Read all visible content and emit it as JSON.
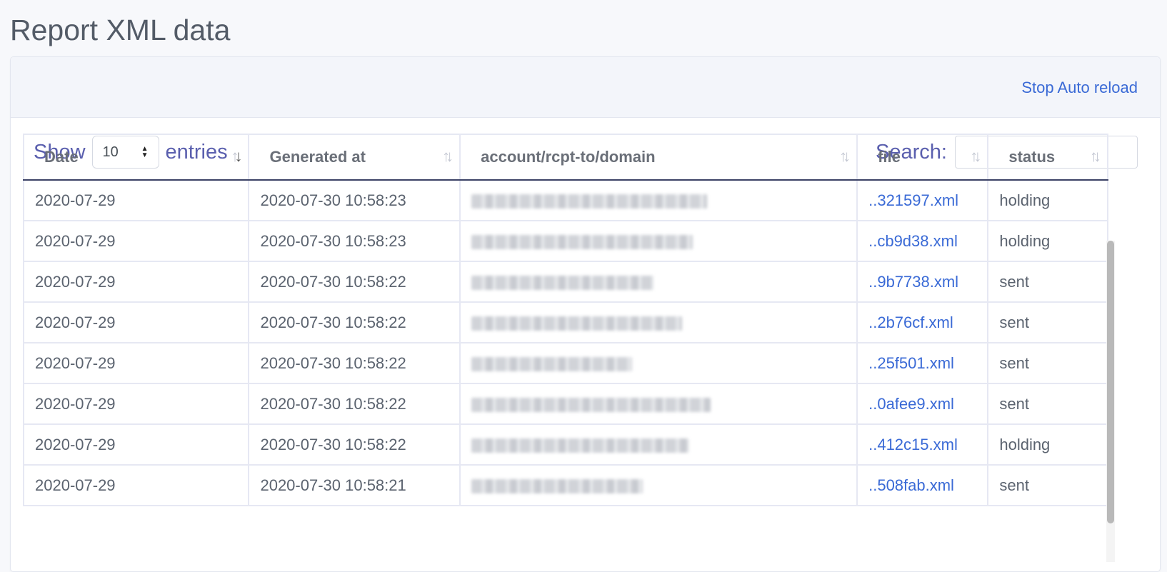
{
  "page": {
    "title": "Report XML data"
  },
  "header": {
    "stop_reload_label": "Stop Auto reload"
  },
  "controls": {
    "show_label": "Show",
    "entries_value": "10",
    "entries_label": "entries",
    "search_label": "Search:",
    "search_value": ""
  },
  "table": {
    "columns": [
      {
        "label": "Date",
        "sorted": "desc"
      },
      {
        "label": "Generated at",
        "sorted": "none"
      },
      {
        "label": "account/rcpt-to/domain",
        "sorted": "none"
      },
      {
        "label": "file",
        "sorted": "none"
      },
      {
        "label": "status",
        "sorted": "none"
      }
    ],
    "rows": [
      {
        "date": "2020-07-29",
        "generated": "2020-07-30 10:58:23",
        "domain_redacted": true,
        "file": "..321597.xml",
        "status": "holding"
      },
      {
        "date": "2020-07-29",
        "generated": "2020-07-30 10:58:23",
        "domain_redacted": true,
        "file": "..cb9d38.xml",
        "status": "holding"
      },
      {
        "date": "2020-07-29",
        "generated": "2020-07-30 10:58:22",
        "domain_redacted": true,
        "file": "..9b7738.xml",
        "status": "sent"
      },
      {
        "date": "2020-07-29",
        "generated": "2020-07-30 10:58:22",
        "domain_redacted": true,
        "file": "..2b76cf.xml",
        "status": "sent"
      },
      {
        "date": "2020-07-29",
        "generated": "2020-07-30 10:58:22",
        "domain_redacted": true,
        "file": "..25f501.xml",
        "status": "sent"
      },
      {
        "date": "2020-07-29",
        "generated": "2020-07-30 10:58:22",
        "domain_redacted": true,
        "file": "..0afee9.xml",
        "status": "sent"
      },
      {
        "date": "2020-07-29",
        "generated": "2020-07-30 10:58:22",
        "domain_redacted": true,
        "file": "..412c15.xml",
        "status": "holding"
      },
      {
        "date": "2020-07-29",
        "generated": "2020-07-30 10:58:21",
        "domain_redacted": true,
        "file": "..508fab.xml",
        "status": "sent"
      }
    ]
  },
  "colors": {
    "link": "#3a6ad6",
    "controls_text": "#5a5fae",
    "header_bg": "#f3f5fa",
    "header_border": "#3c4266"
  }
}
